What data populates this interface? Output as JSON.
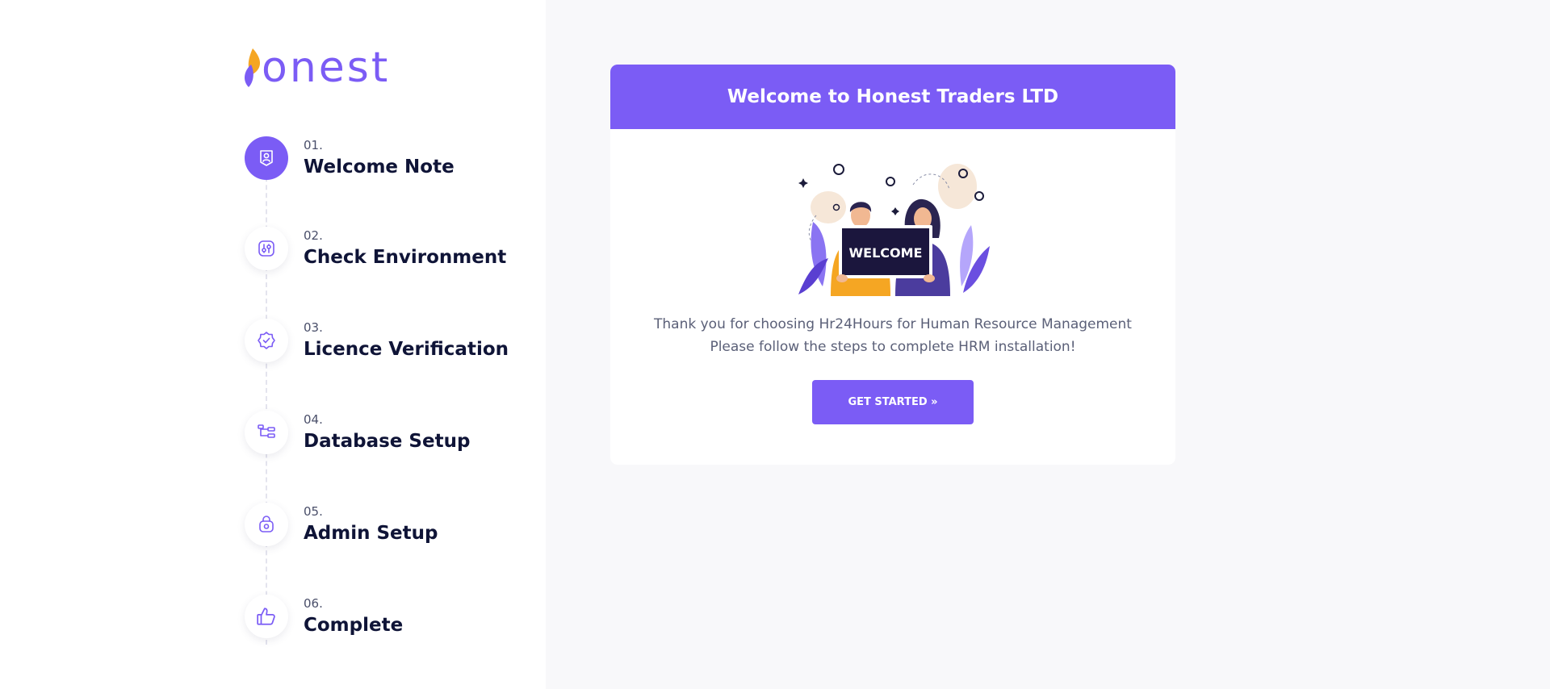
{
  "brand": {
    "logo_text": "onest"
  },
  "steps": [
    {
      "number": "01.",
      "title": "Welcome Note",
      "icon": "person-badge-icon",
      "active": true
    },
    {
      "number": "02.",
      "title": "Check Environment",
      "icon": "settings-sliders-icon",
      "active": false
    },
    {
      "number": "03.",
      "title": "Licence Verification",
      "icon": "verified-badge-icon",
      "active": false
    },
    {
      "number": "04.",
      "title": "Database Setup",
      "icon": "hierarchy-icon",
      "active": false
    },
    {
      "number": "05.",
      "title": "Admin Setup",
      "icon": "admin-lock-icon",
      "active": false
    },
    {
      "number": "06.",
      "title": "Complete",
      "icon": "thumbs-up-icon",
      "active": false
    }
  ],
  "card": {
    "title": "Welcome to Honest Traders LTD",
    "sign_text": "WELCOME",
    "message_line1": "Thank you for choosing Hr24Hours for Human Resource Management",
    "message_line2": "Please follow the steps to complete HRM installation!",
    "button_label": "GET STARTED »"
  },
  "colors": {
    "accent": "#7b5cf5",
    "logo_flame": "#f5a623",
    "heading": "#0f1437",
    "body_text": "#5b6078",
    "background": "#f8f8fa"
  }
}
